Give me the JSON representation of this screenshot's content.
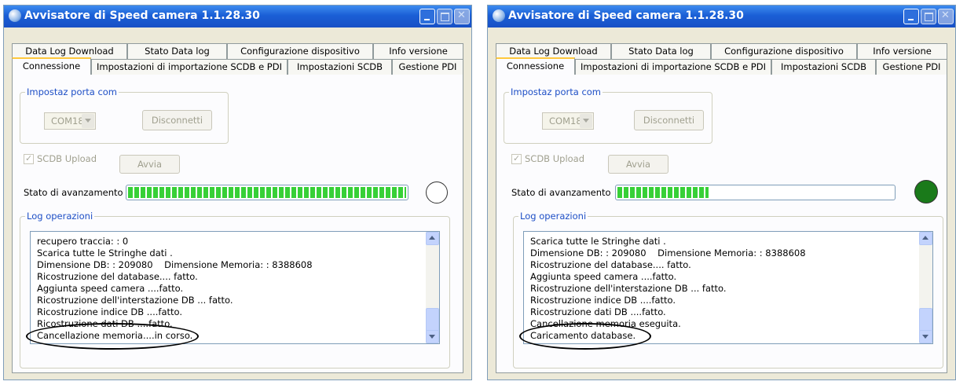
{
  "windows": [
    {
      "title": "Avvisatore di Speed camera  1.1.28.30",
      "tabs_row1": [
        "Data Log Download",
        "Stato Data log",
        "Configurazione dispositivo",
        "Info versione"
      ],
      "tabs_row2": [
        "Connessione",
        "Impostazioni di importazione SCDB e PDI",
        "Impostazioni SCDB",
        "Gestione PDI"
      ],
      "active_tab": "Connessione",
      "com_group_label": "Impostaz porta com",
      "com_port_value": "COM18",
      "disconnect_label": "Disconnetti",
      "scdb_upload_label": "SCDB Upload",
      "scdb_upload_checked": true,
      "start_label": "Avvia",
      "progress_label": "Stato di avanzamento",
      "progress_fraction": 1.0,
      "status_led_color": "#ffffff",
      "log_group_label": "Log operazioni",
      "log_lines": [
        "recupero traccia: : 0",
        "Scarica tutte le Stringhe dati .",
        "Dimensione DB: : 209080    Dimensione Memoria: : 8388608",
        "Ricostruzione del database.... fatto.",
        "Aggiunta speed camera ....fatto.",
        "Ricostruzione dell'interstazione DB ... fatto.",
        "Ricostruzione indice DB ....fatto.",
        "Ricostruzione dati DB ....fatto.",
        "Cancellazione memoria....in corso."
      ]
    },
    {
      "title": "Avvisatore di Speed camera  1.1.28.30",
      "tabs_row1": [
        "Data Log Download",
        "Stato Data log",
        "Configurazione dispositivo",
        "Info versione"
      ],
      "tabs_row2": [
        "Connessione",
        "Impostazioni di importazione SCDB e PDI",
        "Impostazioni SCDB",
        "Gestione PDI"
      ],
      "active_tab": "Connessione",
      "com_group_label": "Impostaz porta com",
      "com_port_value": "COM18",
      "disconnect_label": "Disconnetti",
      "scdb_upload_label": "SCDB Upload",
      "scdb_upload_checked": true,
      "start_label": "Avvia",
      "progress_label": "Stato di avanzamento",
      "progress_fraction": 0.33,
      "status_led_color": "#1a7a1a",
      "log_group_label": "Log operazioni",
      "log_lines": [
        "Scarica tutte le Stringhe dati .",
        "Dimensione DB: : 209080    Dimensione Memoria: : 8388608",
        "Ricostruzione del database.... fatto.",
        "Aggiunta speed camera ....fatto.",
        "Ricostruzione dell'interstazione DB ... fatto.",
        "Ricostruzione indice DB ....fatto.",
        "Ricostruzione dati DB ....fatto.",
        "Cancellazione memoria eseguita.",
        "Caricamento database."
      ]
    }
  ]
}
